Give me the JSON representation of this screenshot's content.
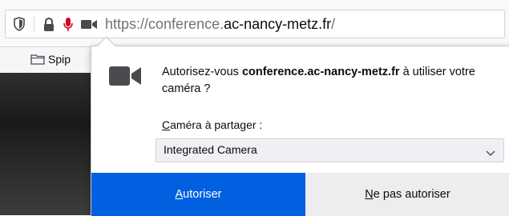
{
  "urlbar": {
    "url_prefix": "https://",
    "url_sub": "conference.",
    "url_host": "ac-nancy-metz.fr",
    "url_suffix": "/"
  },
  "bookmarks": {
    "items": [
      {
        "label": "Spip"
      }
    ]
  },
  "permission_panel": {
    "prompt_start": "Autorisez-vous ",
    "prompt_site": "conference.ac-nancy-metz.fr",
    "prompt_end": " à utiliser votre caméra ?",
    "share_label_accesskey": "C",
    "share_label_rest": "améra à partager :",
    "camera_select": {
      "selected": "Integrated Camera"
    },
    "allow_accesskey": "A",
    "allow_rest": "utoriser",
    "deny_accesskey": "N",
    "deny_rest": "e pas autoriser"
  },
  "colors": {
    "accent": "#0060df",
    "mic_active": "#d70022",
    "icon_gray": "#4a4a4f"
  }
}
